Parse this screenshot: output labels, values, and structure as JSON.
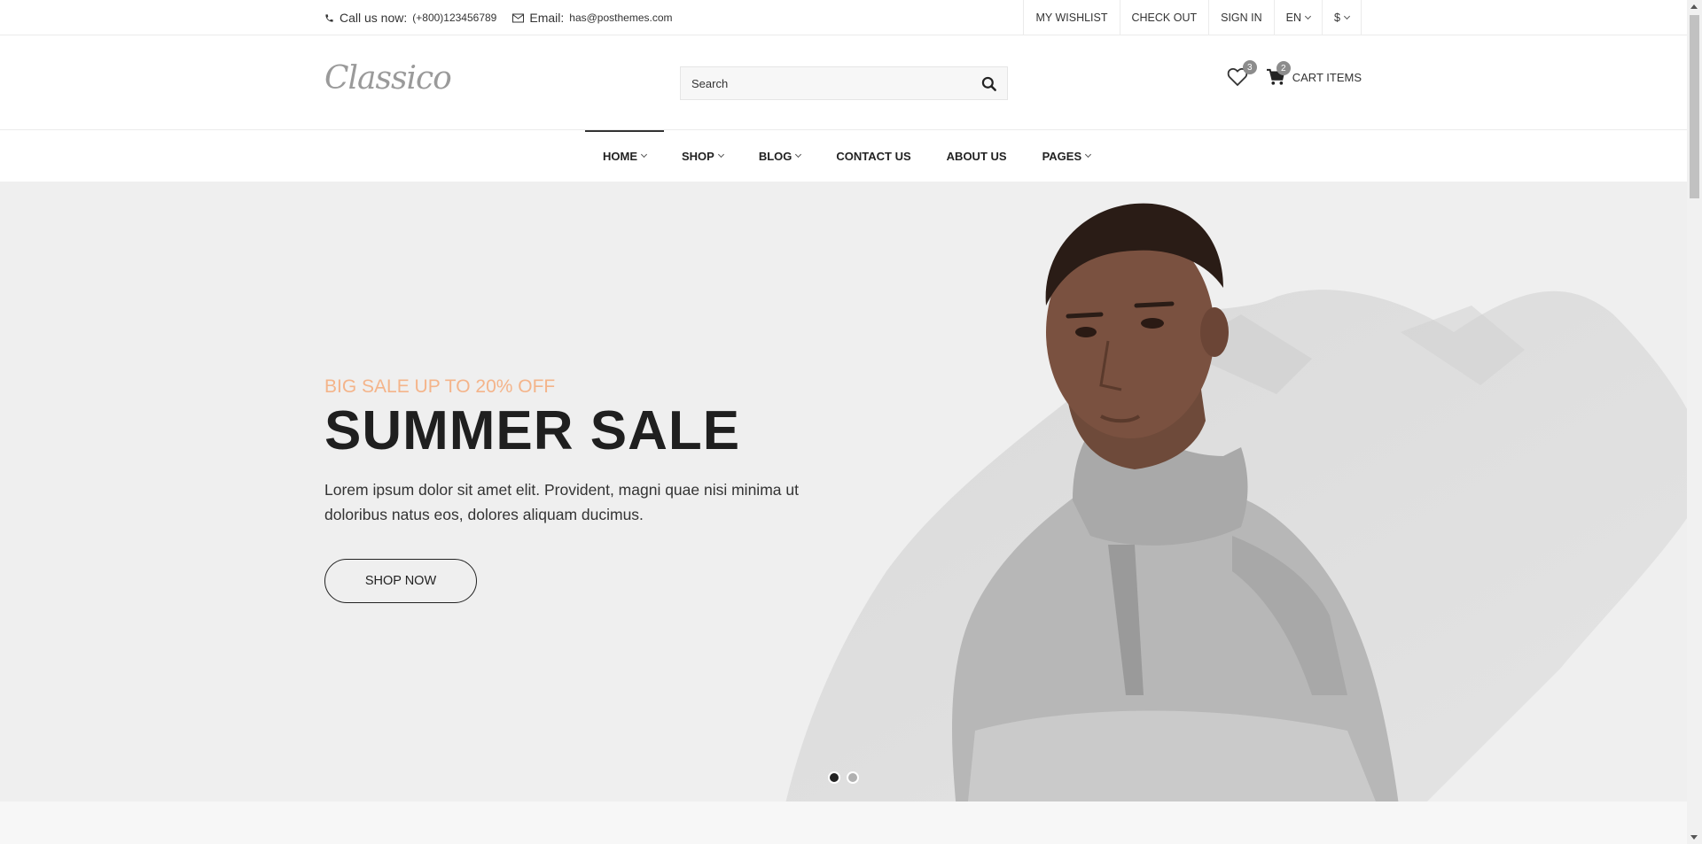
{
  "topbar": {
    "phone_label": "Call us now:",
    "phone_value": "(+800)123456789",
    "email_label": "Email:",
    "email_value": "has@posthemes.com",
    "links": [
      "MY WISHLIST",
      "CHECK OUT",
      "SIGN IN"
    ],
    "language": "EN",
    "currency": "$"
  },
  "header": {
    "logo": "Classico",
    "search_placeholder": "Search",
    "wishlist_count": "3",
    "cart_count": "2",
    "cart_label": "CART ITEMS"
  },
  "nav": {
    "items": [
      {
        "label": "HOME",
        "dropdown": true,
        "active": true
      },
      {
        "label": "SHOP",
        "dropdown": true
      },
      {
        "label": "BLOG",
        "dropdown": true
      },
      {
        "label": "CONTACT US",
        "dropdown": false
      },
      {
        "label": "ABOUT US",
        "dropdown": false
      },
      {
        "label": "PAGES",
        "dropdown": true
      }
    ]
  },
  "hero": {
    "subtitle": "BIG SALE UP TO 20% OFF",
    "title": "SUMMER SALE",
    "description": "Lorem ipsum dolor sit amet elit. Provident, magni quae nisi minima ut doloribus natus eos, dolores aliquam ducimus.",
    "button": "SHOP NOW",
    "slides": 2,
    "active_slide": 1
  },
  "colors": {
    "accent": "#f4b48a",
    "hero_bg": "#efefef",
    "text": "#222222"
  },
  "icons": [
    "phone-icon",
    "mail-icon",
    "search-icon",
    "heart-icon",
    "cart-icon"
  ]
}
